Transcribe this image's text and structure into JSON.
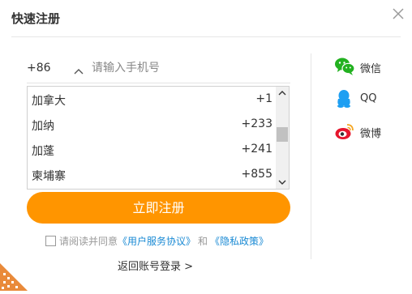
{
  "dialog": {
    "title": "快速注册",
    "close_icon": "close-icon"
  },
  "phone": {
    "country_code": "+86",
    "chevron_icon": "chevron-up-icon",
    "placeholder": "请输入手机号",
    "value": ""
  },
  "country_list": {
    "items": [
      {
        "name": "加拿大",
        "code": "+1"
      },
      {
        "name": "加纳",
        "code": "+233"
      },
      {
        "name": "加蓬",
        "code": "+241"
      },
      {
        "name": "柬埔寨",
        "code": "+855"
      }
    ],
    "scroll_position": 0.45
  },
  "register_button": "立即注册",
  "agreement": {
    "prefix": "请阅读并同意",
    "user_agreement": "《用户服务协议》",
    "and": "和",
    "privacy_policy": "《隐私政策》",
    "checked": false
  },
  "back_to_login": "返回账号登录 >",
  "social": [
    {
      "label": "微信",
      "icon": "wechat-icon",
      "color": "#22b120"
    },
    {
      "label": "QQ",
      "icon": "qq-icon",
      "color": "#1e9ff2"
    },
    {
      "label": "微博",
      "icon": "weibo-icon",
      "color": "#e6162d"
    }
  ],
  "colors": {
    "accent": "#ff9500",
    "link": "#1a8ad4",
    "corner_pattern": "#e98a3a"
  }
}
